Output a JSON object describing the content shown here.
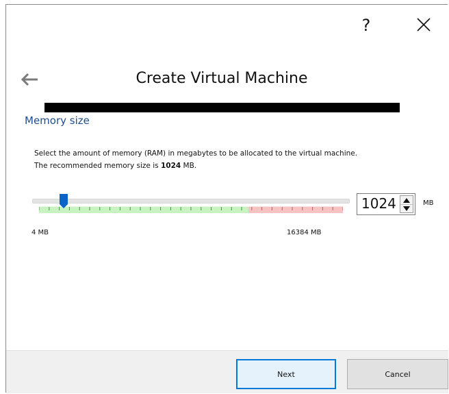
{
  "titlebar": {
    "help_label": "?"
  },
  "wizard": {
    "title": "Create Virtual Machine"
  },
  "section": {
    "title": "Memory size",
    "desc_line1": "Select the amount of memory (RAM) in megabytes to be allocated to the virtual machine.",
    "desc_line2_prefix": "The recommended memory size is ",
    "desc_line2_value": "1024",
    "desc_line2_suffix": " MB."
  },
  "memory": {
    "value": "1024",
    "unit": "MB",
    "min_label": "4 MB",
    "max_label": "16384 MB",
    "slider_min": 4,
    "slider_max": 16384,
    "slider_value": 1024
  },
  "footer": {
    "next_label": "Next",
    "cancel_label": "Cancel"
  },
  "colors": {
    "accent": "#0078d7",
    "section_title": "#1f4e8c",
    "scale_ok": "#c8f2c2",
    "scale_warn": "#f6c3c3"
  }
}
